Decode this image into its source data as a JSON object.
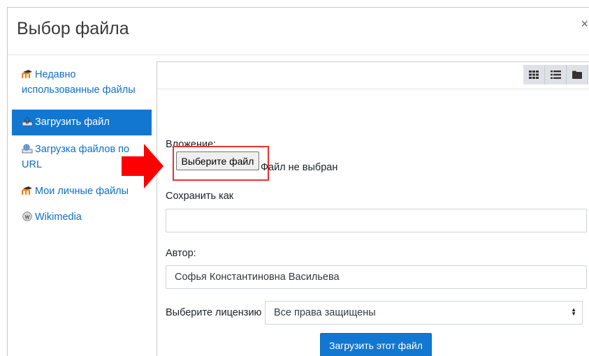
{
  "dialog": {
    "title": "Выбор файла",
    "close_symbol": "×"
  },
  "sidebar": {
    "items": [
      {
        "label": "Недавно использованные файлы",
        "icon": "moodle-icon"
      },
      {
        "label": "Загрузить файл",
        "icon": "upload-icon",
        "active": true
      },
      {
        "label": "Загрузка файлов по URL",
        "icon": "url-download-icon"
      },
      {
        "label": "Мои личные файлы",
        "icon": "moodle-icon"
      },
      {
        "label": "Wikimedia",
        "icon": "wikimedia-icon"
      }
    ]
  },
  "toolbar": {
    "views": [
      "grid-view-icon",
      "list-view-icon",
      "folder-view-icon"
    ]
  },
  "form": {
    "attachment_label": "Вложение:",
    "choose_file_button": "Выберите файл",
    "no_file_text": "Файл не выбран",
    "save_as_label": "Сохранить как",
    "save_as_value": "",
    "author_label": "Автор:",
    "author_value": "Софья Константиновна Васильева",
    "license_label": "Выберите лицензию",
    "license_value": "Все права защищены",
    "upload_button": "Загрузить этот файл"
  },
  "colors": {
    "accent": "#1177d1",
    "link": "#0f6fc5",
    "highlight": "#e8322e",
    "arrow": "#ff0000"
  }
}
